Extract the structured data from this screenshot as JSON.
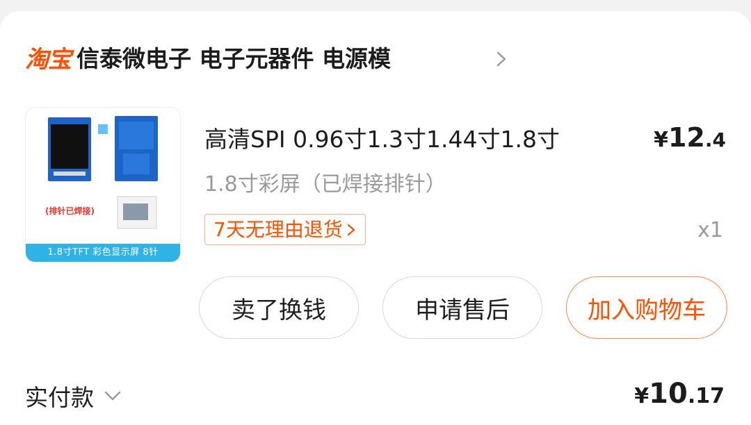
{
  "shop": {
    "platform_logo": "淘宝",
    "name": "信泰微电子 电子元器件 电源模",
    "chevron_icon": "chevron-right-icon"
  },
  "product": {
    "image_caption": "1.8寸TFT 彩色显示屏 8针",
    "image_tag": "(排针已焊接)",
    "title": "高清SPI 0.96寸1.3寸1.44寸1.8寸",
    "sku": "1.8寸彩屏（已焊接排针）",
    "return_policy": "7天无理由退货",
    "price": {
      "symbol": "¥",
      "integer": "12",
      "decimal": ".4"
    },
    "quantity": "x1"
  },
  "actions": {
    "sell_label": "卖了换钱",
    "after_sale_label": "申请售后",
    "add_cart_label": "加入购物车"
  },
  "payment": {
    "label": "实付款",
    "amount": {
      "symbol": "¥",
      "integer": "10",
      "decimal": ".17"
    }
  },
  "colors": {
    "accent": "#ff5000",
    "caption_bar": "#2fb3e6",
    "pcb_blue": "#1e64c8"
  }
}
